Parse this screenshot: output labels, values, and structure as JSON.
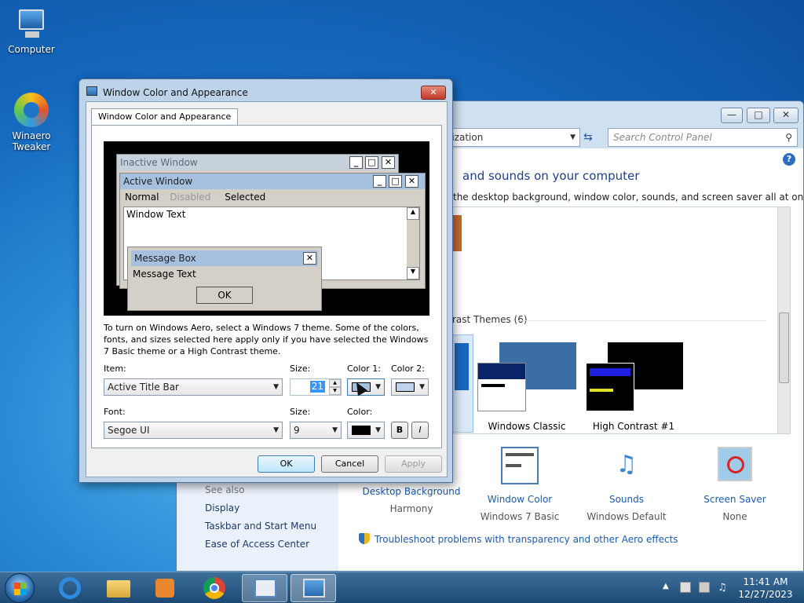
{
  "desktop": {
    "icons": [
      {
        "label": "Computer"
      },
      {
        "label": "Winaero Tweaker"
      }
    ]
  },
  "control_panel": {
    "address_text": "lization",
    "search_placeholder": "Search Control Panel",
    "heading": "and sounds on your computer",
    "subtitle": "the desktop background, window color, sounds, and screen saver all at once.",
    "section_label": "rast Themes (6)",
    "themes": [
      {
        "label": "Windows Classic"
      },
      {
        "label": "High Contrast #1"
      }
    ],
    "bottom_items": [
      {
        "label": "Desktop Background",
        "value": "Harmony"
      },
      {
        "label": "Window Color",
        "value": "Windows 7 Basic"
      },
      {
        "label": "Sounds",
        "value": "Windows Default"
      },
      {
        "label": "Screen Saver",
        "value": "None"
      }
    ],
    "troubleshoot_link": "Troubleshoot problems with transparency and other Aero effects",
    "left_links": {
      "see_also": "See also",
      "items": [
        "Display",
        "Taskbar and Start Menu",
        "Ease of Access Center"
      ]
    }
  },
  "dialog": {
    "title": "Window Color and Appearance",
    "tab_label": "Window Color and Appearance",
    "preview": {
      "inactive_title": "Inactive Window",
      "active_title": "Active Window",
      "menu": [
        "Normal",
        "Disabled",
        "Selected"
      ],
      "window_text": "Window Text",
      "message_title": "Message Box",
      "message_text": "Message Text",
      "ok": "OK"
    },
    "info_text": "To turn on Windows Aero, select a Windows 7 theme.  Some of the colors, fonts, and sizes selected here apply only if you have selected the Windows 7 Basic theme or a High Contrast theme.",
    "labels": {
      "item": "Item:",
      "size": "Size:",
      "color1": "Color 1:",
      "color2": "Color 2:",
      "font": "Font:",
      "font_size": "Size:",
      "font_color": "Color:"
    },
    "item_value": "Active Title Bar",
    "size_value": "21",
    "font_value": "Segoe UI",
    "font_size_value": "9",
    "bold_label": "B",
    "italic_label": "I",
    "buttons": {
      "ok": "OK",
      "cancel": "Cancel",
      "apply": "Apply"
    },
    "colors": {
      "color1": "#a6c0df",
      "color2": "#bfd3ef",
      "font_color": "#000000"
    }
  },
  "taskbar": {
    "time": "11:41 AM",
    "date": "12/27/2023"
  }
}
